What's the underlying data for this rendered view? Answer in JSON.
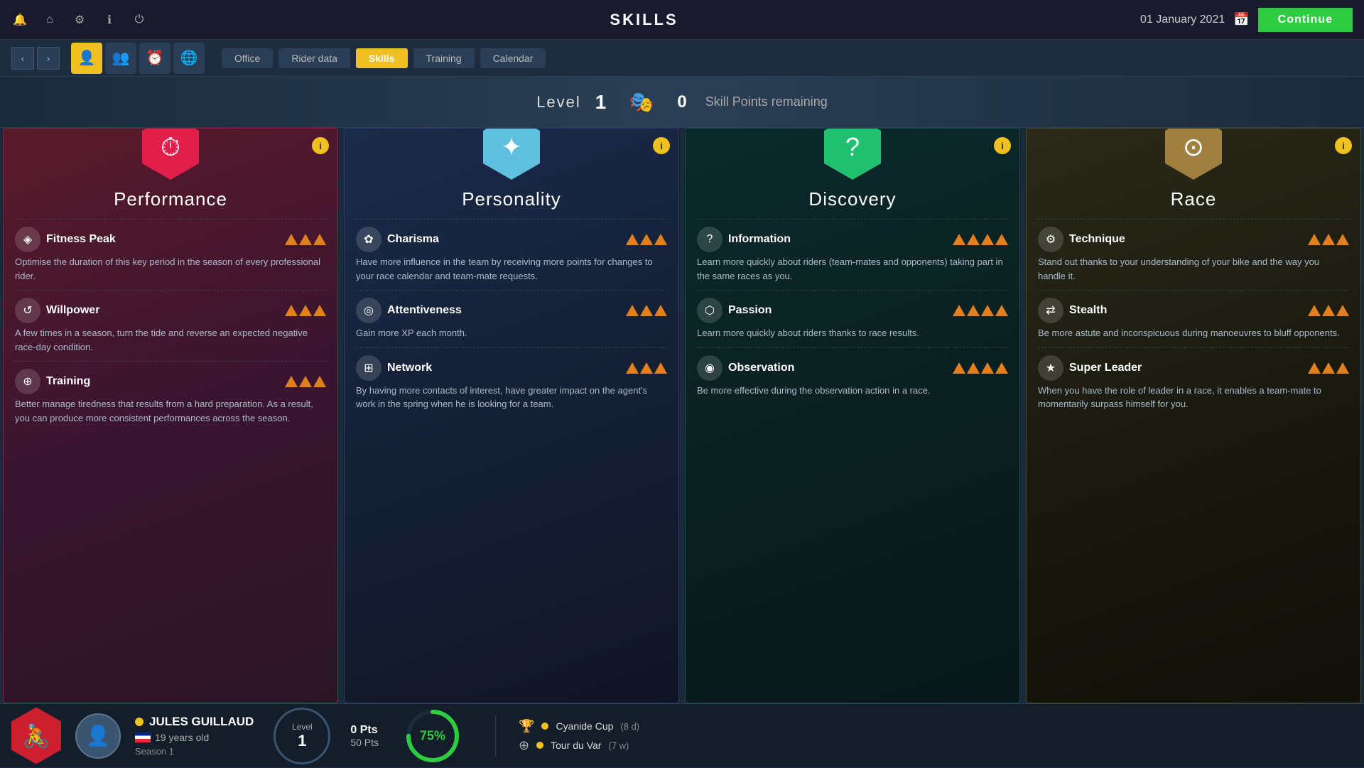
{
  "topbar": {
    "title": "SKILLS",
    "date": "01 January 2021",
    "continue_label": "Continue"
  },
  "nav": {
    "tabs": [
      {
        "label": "Office",
        "active": false
      },
      {
        "label": "Rider data",
        "active": false
      },
      {
        "label": "Skills",
        "active": true
      },
      {
        "label": "Training",
        "active": false
      },
      {
        "label": "Calendar",
        "active": false
      }
    ]
  },
  "level_bar": {
    "level_label": "Level",
    "level_value": "1",
    "skill_points": "0",
    "skill_points_label": "Skill Points remaining"
  },
  "cards": [
    {
      "id": "performance",
      "title": "Performance",
      "icon": "⏱",
      "skills": [
        {
          "name": "Fitness Peak",
          "icon": "◈",
          "triangles": 3,
          "desc": "Optimise the duration of this key period in the season of every professional rider."
        },
        {
          "name": "Willpower",
          "icon": "↺",
          "triangles": 3,
          "desc": "A few times in a season, turn the tide and reverse an expected negative race-day condition."
        },
        {
          "name": "Training",
          "icon": "⊕",
          "triangles": 3,
          "desc": "Better manage tiredness that results from a hard preparation. As a result, you can produce more consistent performances across the season."
        }
      ]
    },
    {
      "id": "personality",
      "title": "Personality",
      "icon": "✦",
      "skills": [
        {
          "name": "Charisma",
          "icon": "✿",
          "triangles": 3,
          "desc": "Have more influence in the team by receiving more points for changes to your race calendar and team-mate requests."
        },
        {
          "name": "Attentiveness",
          "icon": "◎",
          "triangles": 3,
          "desc": "Gain more XP each month."
        },
        {
          "name": "Network",
          "icon": "⊞",
          "triangles": 3,
          "desc": "By having more contacts of interest, have greater impact on the agent's work in the spring when he is looking for a team."
        }
      ]
    },
    {
      "id": "discovery",
      "title": "Discovery",
      "icon": "?",
      "skills": [
        {
          "name": "Information",
          "icon": "?",
          "triangles": 4,
          "desc": "Learn more quickly about riders (team-mates and opponents) taking part in the same races as you."
        },
        {
          "name": "Passion",
          "icon": "⬡",
          "triangles": 4,
          "desc": "Learn more quickly about riders thanks to race results."
        },
        {
          "name": "Observation",
          "icon": "◉",
          "triangles": 4,
          "desc": "Be more effective during the observation action in a race."
        }
      ]
    },
    {
      "id": "race",
      "title": "Race",
      "icon": "⊙",
      "skills": [
        {
          "name": "Technique",
          "icon": "⚙",
          "triangles": 3,
          "desc": "Stand out thanks to your understanding of your bike and the way you handle it."
        },
        {
          "name": "Stealth",
          "icon": "⇄",
          "triangles": 3,
          "desc": "Be more astute and inconspicuous during manoeuvres to bluff opponents."
        },
        {
          "name": "Super Leader",
          "icon": "★",
          "triangles": 3,
          "desc": "When you have the role of leader in a race, it enables a team-mate to momentarily surpass himself for you."
        }
      ]
    }
  ],
  "bottom": {
    "rider_name": "JULES GUILLAUD",
    "rider_age": "19 years old",
    "rider_season": "Season 1",
    "level_label": "Level",
    "level_value": "1",
    "pts_current": "0 Pts",
    "pts_max": "50 Pts",
    "progress_pct": "75%",
    "races": [
      {
        "name": "Cyanide Cup",
        "time": "(8 d)",
        "icon": "🏆"
      },
      {
        "name": "Tour du Var",
        "time": "(7 w)",
        "icon": "⊕"
      }
    ]
  }
}
